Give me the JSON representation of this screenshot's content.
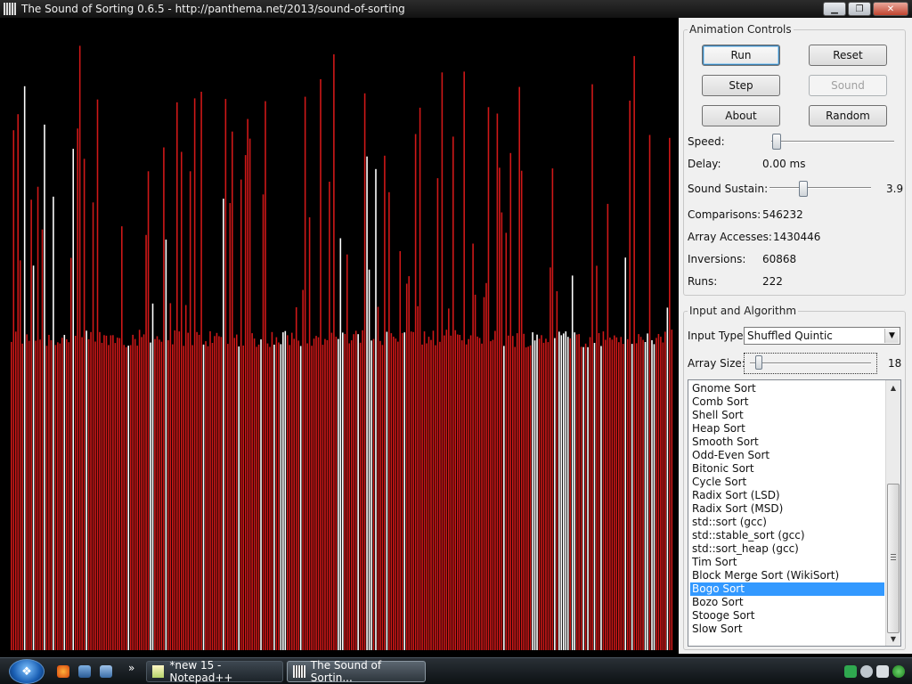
{
  "window": {
    "title": "The Sound of Sorting 0.6.5 - http://panthema.net/2013/sound-of-sorting",
    "minimize_icon": "minimize-icon",
    "maximize_icon": "maximize-icon",
    "close_icon": "close-icon",
    "minimize_glyph": "▁",
    "maximize_glyph": "❐",
    "close_glyph": "✕"
  },
  "visualization": {
    "background": "#000000",
    "bar_color": "#cc1111",
    "highlight_color": "#ffffff",
    "colors": {
      "normal": "#d01818",
      "highlight": "#ffffff"
    }
  },
  "animation_controls": {
    "legend": "Animation Controls",
    "buttons": {
      "run": "Run",
      "reset": "Reset",
      "step": "Step",
      "sound": "Sound",
      "about": "About",
      "random": "Random"
    },
    "speed_label": "Speed:",
    "delay_label": "Delay:",
    "delay_value": "0.00 ms",
    "sustain_label": "Sound Sustain:",
    "sustain_value": "3.9",
    "comparisons_label": "Comparisons:",
    "comparisons_value": "546232",
    "accesses_label": "Array Accesses:",
    "accesses_value": "1430446",
    "inversions_label": "Inversions:",
    "inversions_value": "60868",
    "runs_label": "Runs:",
    "runs_value": "222"
  },
  "input_algorithm": {
    "legend": "Input and Algorithm",
    "input_type_label": "Input Type:",
    "input_type_value": "Shuffled Quintic",
    "array_size_label": "Array Size:",
    "array_size_value": "18",
    "algorithms": [
      "Gnome Sort",
      "Comb Sort",
      "Shell Sort",
      "Heap Sort",
      "Smooth Sort",
      "Odd-Even Sort",
      "Bitonic Sort",
      "Cycle Sort",
      "Radix Sort (LSD)",
      "Radix Sort (MSD)",
      "std::sort (gcc)",
      "std::stable_sort (gcc)",
      "std::sort_heap (gcc)",
      "Tim Sort",
      "Block Merge Sort (WikiSort)",
      "Bogo Sort",
      "Bozo Sort",
      "Stooge Sort",
      "Slow Sort"
    ],
    "selected_algorithm": "Bogo Sort"
  },
  "taskbar": {
    "start_icon": "windows-start-icon",
    "start_glyph": "❖",
    "quicklaunch_overflow": "»",
    "tasks": [
      {
        "label": "*new 15 - Notepad++",
        "active": false
      },
      {
        "label": "The Sound of Sortin...",
        "active": true
      }
    ]
  },
  "sliders": {
    "speed_fraction": 0.01,
    "sustain_fraction": 0.32,
    "array_size_fraction": 0.05
  },
  "scroll": {
    "up_glyph": "▲",
    "down_glyph": "▼",
    "combo_glyph": "▼"
  }
}
